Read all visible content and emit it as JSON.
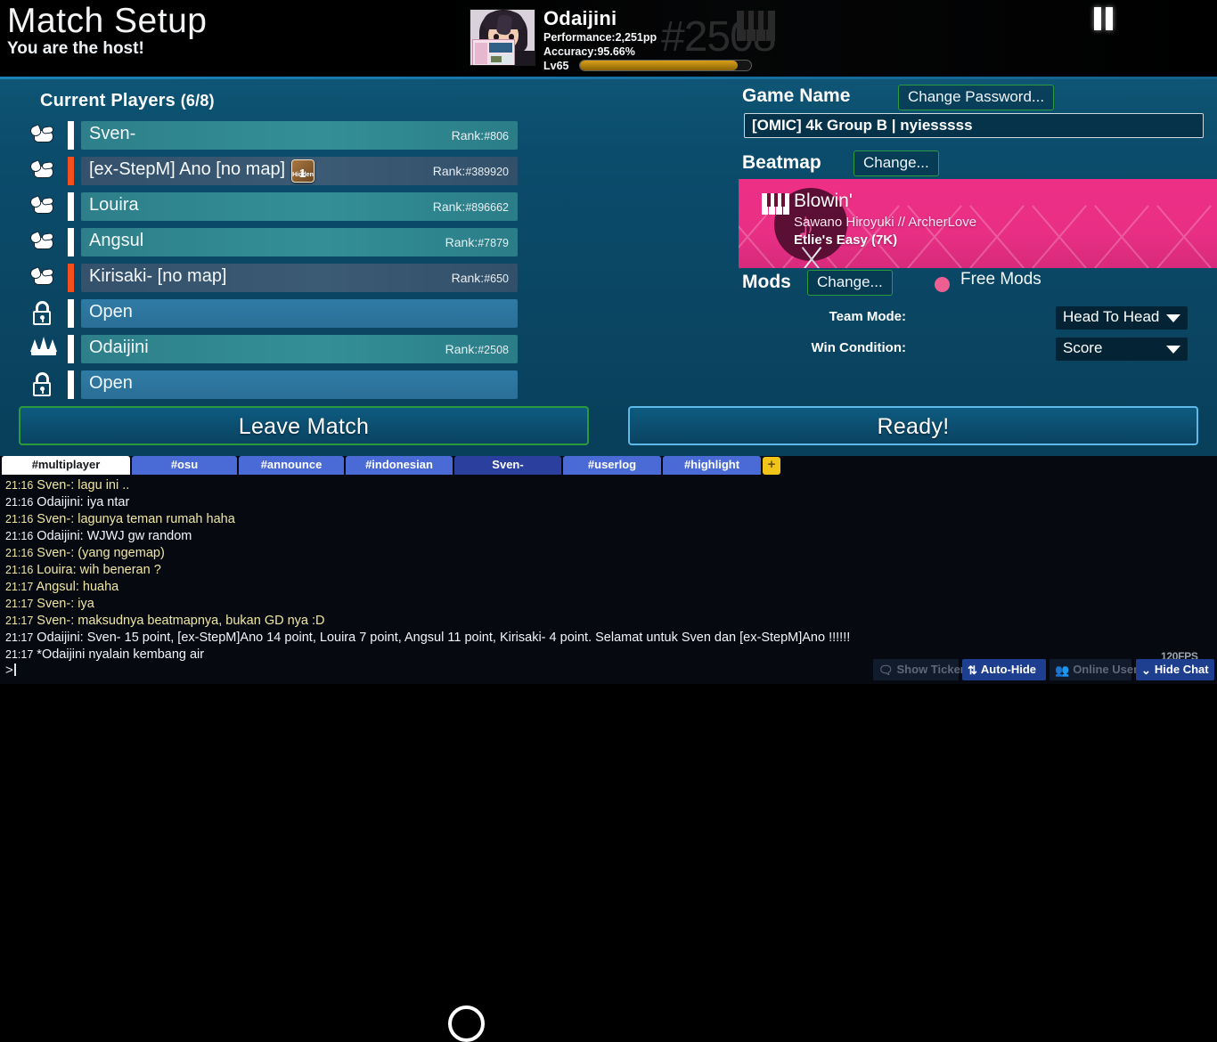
{
  "header": {
    "title": "Match Setup",
    "subtitle": "You are the host!",
    "pause_icon": "pause-icon",
    "user": {
      "name": "Odaijini",
      "performance": "Performance:2,251pp",
      "accuracy": "Accuracy:95.66%",
      "level": "Lv65",
      "rank_watermark": "#2508",
      "level_progress_percent": 92
    }
  },
  "players_panel": {
    "title": "Current Players",
    "count_label": "(6/8)",
    "rank_prefix": "Rank:",
    "open_label": "Open",
    "rows": [
      {
        "slot_icon": "ready-hand-icon",
        "name": "Sven-",
        "rank": "#806",
        "team_color": "#ffffff",
        "occupied": true,
        "highlight": true,
        "mod": null
      },
      {
        "slot_icon": "ready-hand-icon",
        "name": "[ex-StepM] Ano [no map]",
        "rank": "#389920",
        "team_color": "#f4501e",
        "occupied": true,
        "highlight": false,
        "mod": "Hidden"
      },
      {
        "slot_icon": "ready-hand-icon",
        "name": "Louira",
        "rank": "#896662",
        "team_color": "#ffffff",
        "occupied": true,
        "highlight": true,
        "mod": null
      },
      {
        "slot_icon": "ready-hand-icon",
        "name": "Angsul",
        "rank": "#7879",
        "team_color": "#ffffff",
        "occupied": true,
        "highlight": true,
        "mod": null
      },
      {
        "slot_icon": "ready-hand-icon",
        "name": "Kirisaki- [no map]",
        "rank": "#650",
        "team_color": "#f4501e",
        "occupied": true,
        "highlight": false,
        "mod": null
      },
      {
        "slot_icon": "open-padlock-icon",
        "name": "Open",
        "rank": "",
        "team_color": "#ffffff",
        "occupied": false,
        "highlight": false,
        "mod": null
      },
      {
        "slot_icon": "host-crown-icon",
        "name": "Odaijini",
        "rank": "#2508",
        "team_color": "#ffffff",
        "occupied": true,
        "highlight": true,
        "mod": null
      },
      {
        "slot_icon": "open-padlock-icon",
        "name": "Open",
        "rank": "",
        "team_color": "#ffffff",
        "occupied": false,
        "highlight": false,
        "mod": null
      }
    ]
  },
  "actions": {
    "leave_label": "Leave Match",
    "ready_label": "Ready!"
  },
  "settings": {
    "game_name_label": "Game Name",
    "change_password_label": "Change Password...",
    "game_name_value": "[OMIC] 4k Group B | nyiesssss",
    "beatmap_label": "Beatmap",
    "change_beatmap_label": "Change...",
    "beatmap": {
      "title": "Blowin'",
      "artist": "Sawano Hiroyuki // ArcherLove",
      "difficulty": "Etlie's Easy (7K)",
      "card_color": "#ea2f85"
    },
    "mods_label": "Mods",
    "change_mods_label": "Change...",
    "free_mods_label": "Free Mods",
    "free_mods_dot_color": "#ee5f91",
    "team_mode_label": "Team Mode:",
    "team_mode_value": "Head To Head",
    "win_condition_label": "Win Condition:",
    "win_condition_value": "Score"
  },
  "chat": {
    "tabs": [
      {
        "label": "#multiplayer",
        "active": true,
        "pm": false
      },
      {
        "label": "#osu",
        "active": false,
        "pm": false
      },
      {
        "label": "#announce",
        "active": false,
        "pm": false
      },
      {
        "label": "#indonesian",
        "active": false,
        "pm": false
      },
      {
        "label": "Sven-",
        "active": false,
        "pm": true
      },
      {
        "label": "#userlog",
        "active": false,
        "pm": false
      },
      {
        "label": "#highlight",
        "active": false,
        "pm": false
      }
    ],
    "add_tab_label": "+",
    "messages": [
      {
        "time": "21:16",
        "text": " Sven-: lagu ini ..",
        "style": "yellow"
      },
      {
        "time": "21:16",
        "text": " Odaijini: iya ntar",
        "style": "white"
      },
      {
        "time": "21:16",
        "text": " Sven-: lagunya teman rumah haha",
        "style": "yellow"
      },
      {
        "time": "21:16",
        "text": " Odaijini: WJWJ gw random",
        "style": "white"
      },
      {
        "time": "21:16",
        "text": " Sven-: (yang ngemap)",
        "style": "yellow"
      },
      {
        "time": "21:16",
        "text": " Louira: wih beneran ?",
        "style": "yellow"
      },
      {
        "time": "21:17",
        "text": " Angsul: huaha",
        "style": "yellow"
      },
      {
        "time": "21:17",
        "text": " Sven-: iya",
        "style": "yellow"
      },
      {
        "time": "21:17",
        "text": " Sven-: maksudnya beatmapnya, bukan GD nya :D",
        "style": "yellow"
      },
      {
        "time": "21:17",
        "text": " Odaijini: Sven- 15 point, [ex-StepM]Ano 14 point, Louira 7 point, Angsul 11 point, Kirisaki- 4 point. Selamat untuk Sven dan [ex-StepM]Ano !!!!!!",
        "style": "white"
      },
      {
        "time": "21:17",
        "text": " *Odaijini nyalain kembang air",
        "style": "action"
      }
    ],
    "input_prompt": ">"
  },
  "statusbar": {
    "fps": "120FPS",
    "buttons": [
      {
        "label": "Show Ticker",
        "icon": "speech-bubble-icon",
        "active": false
      },
      {
        "label": "Auto-Hide",
        "icon": "updown-arrow-icon",
        "active": true
      },
      {
        "label": "Online Users",
        "icon": "people-icon",
        "active": false
      },
      {
        "label": "Hide Chat",
        "icon": "chevron-down-icon",
        "active": true
      }
    ]
  }
}
